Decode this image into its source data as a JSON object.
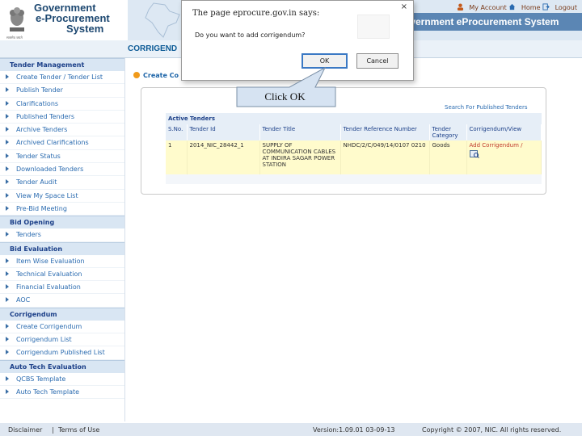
{
  "header": {
    "brand_line1": "Government",
    "brand_line2": "e-Procurement",
    "brand_line3": "System",
    "emblem_caption": "सत्यमेव जयते",
    "system_title": "overnment eProcurement System",
    "links": [
      "My Account",
      "Home",
      "Logout"
    ]
  },
  "page_heading": "CORRIGEND",
  "breadcrumb": "Create Co",
  "sidebar": {
    "sections": [
      {
        "title": "Tender Management",
        "items": [
          "Create Tender / Tender List",
          "Publish Tender",
          "Clarifications",
          "Published Tenders",
          "Archive Tenders",
          "Archived Clarifications",
          "Tender Status",
          "Downloaded Tenders",
          "Tender Audit",
          "View My Space List",
          "Pre-Bid Meeting"
        ]
      },
      {
        "title": "Bid Opening",
        "items": [
          "Tenders"
        ]
      },
      {
        "title": "Bid Evaluation",
        "items": [
          "Item Wise Evaluation",
          "Technical Evaluation",
          "Financial Evaluation",
          "AOC"
        ]
      },
      {
        "title": "Corrigendum",
        "items": [
          "Create Corrigendum",
          "Corrigendum List",
          "Corrigendum Published List"
        ]
      },
      {
        "title": "Auto Tech Evaluation",
        "items": [
          "QCBS Template",
          "Auto Tech Template"
        ]
      }
    ]
  },
  "content": {
    "search_link": "Search For Published Tenders",
    "table_title": "Active Tenders",
    "columns": [
      "S.No.",
      "Tender Id",
      "Tender Title",
      "Tender Reference Number",
      "Tender Category",
      "Corrigendum/View"
    ],
    "rows": [
      {
        "sno": "1",
        "tender_id": "2014_NIC_28442_1",
        "title": "SUPPLY OF COMMUNICATION CABLES AT INDIRA SAGAR POWER STATION",
        "ref": "NHDC/2/C/049/14/0107 0210",
        "category": "Goods",
        "action": "Add Corrigendum /"
      }
    ]
  },
  "dialog": {
    "title": "The page eprocure.gov.in says:",
    "message": "Do you want to add corrigendum?",
    "ok_label": "OK",
    "cancel_label": "Cancel",
    "close": "×"
  },
  "callout": {
    "text": "Click OK"
  },
  "footer": {
    "disclaimer": "Disclaimer",
    "separator": "|",
    "terms": "Terms of Use",
    "version": "Version:1.09.01 03-09-13",
    "copyright": "Copyright © 2007, NIC. All rights reserved."
  },
  "colors": {
    "accent": "#1b3f88",
    "link": "#2a6bb0",
    "row_highlight": "#fffbcc",
    "callout_bg": "#d6e3f2"
  }
}
